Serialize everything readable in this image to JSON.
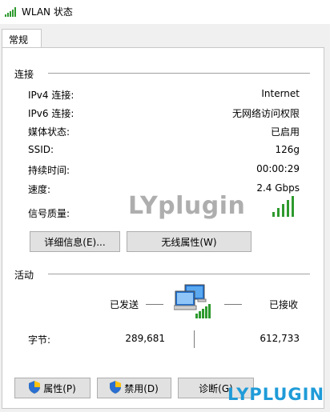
{
  "window": {
    "title": "WLAN 状态",
    "icon": "wifi-signal-icon"
  },
  "tabs": [
    {
      "label": "常规"
    }
  ],
  "connection": {
    "section_title": "连接",
    "rows": [
      {
        "label": "IPv4 连接:",
        "value": "Internet"
      },
      {
        "label": "IPv6 连接:",
        "value": "无网络访问权限"
      },
      {
        "label": "媒体状态:",
        "value": "已启用"
      },
      {
        "label": "SSID:",
        "value": "126g"
      },
      {
        "label": "持续时间:",
        "value": "00:00:29"
      },
      {
        "label": "速度:",
        "value": "2.4 Gbps"
      }
    ],
    "signal_label": "信号质量:",
    "signal_bars_filled": 5,
    "signal_bars_total": 5,
    "details_button": "详细信息(E)...",
    "wireless_props_button": "无线属性(W)"
  },
  "activity": {
    "section_title": "活动",
    "sent_label": "已发送",
    "received_label": "已接收",
    "bytes_label": "字节:",
    "bytes_sent": "289,681",
    "bytes_received": "612,733"
  },
  "buttons": {
    "properties": "属性(P)",
    "disable": "禁用(D)",
    "diagnose": "诊断(G)"
  },
  "watermark": "LYplugin",
  "corner_watermark": "LYPLUGIN",
  "colors": {
    "signal_green": "#2e9a2e",
    "window_bg": "#f0f0f0",
    "watermark_blue": "#1f9bd8"
  }
}
